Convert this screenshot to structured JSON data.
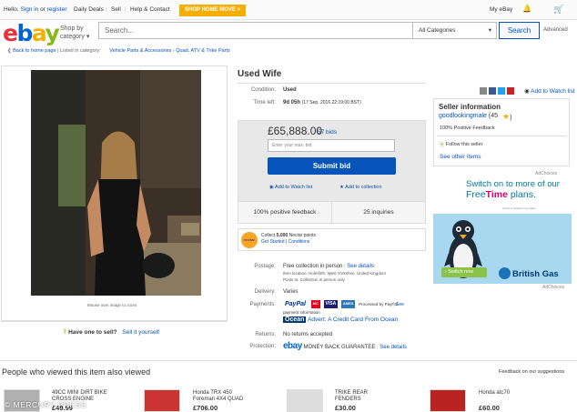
{
  "topbar": {
    "greeting": "Hello.",
    "signin": "Sign in",
    "or": "or",
    "register": "register",
    "daily_deals": "Daily Deals",
    "sell": "Sell",
    "help": "Help & Contact",
    "shop_home": "SHOP HOME MOVE >",
    "my_ebay": "My eBay"
  },
  "header": {
    "shop_by": "Shop by",
    "category": "category",
    "search_placeholder": "Search...",
    "all_categories": "All Categories",
    "search_button": "Search",
    "advanced": "Advanced"
  },
  "breadcrumb": {
    "back": "Back to home page",
    "listed_in": "| Listed in category:",
    "cat1": "Vehicle Parts & Accessories",
    "cat2": "Quad, ATV & Trike Parts"
  },
  "image": {
    "caption": "Mouse over image to zoom"
  },
  "sell_prompt": {
    "have_one": "Have one to sell?",
    "sell_it": "Sell it yourself"
  },
  "item": {
    "title": "Used Wife",
    "condition_label": "Condition:",
    "condition": "Used",
    "time_left_label": "Time left:",
    "time_left": "9d 05h",
    "time_left_detail": "(17 Sep, 2016  22:19:00 BST)"
  },
  "bid": {
    "price": "£65,888.00",
    "bids": "57 bids",
    "max_placeholder": "Enter your max. bid",
    "submit": "Submit bid",
    "add_watch": "Add to Watch list",
    "add_collection": "Add to collection",
    "positive_feedback": "100% positive feedback",
    "inquiries": "25 inquiries"
  },
  "nectar": {
    "logo": "nectar",
    "line1_pre": "Collect ",
    "line1_bold": "5,000",
    "line1_post": " Nectar points",
    "get_started": "Get Started",
    "conditions": "Conditions",
    "sep": " | "
  },
  "social": {
    "add_watch": "Add to Watch list"
  },
  "seller": {
    "heading": "Seller information",
    "name": "goodlookingmale",
    "rating": "(45",
    "rating_end": ")",
    "positive": "100% Positive Feedback",
    "follow": "Follow this seller",
    "see_other": "See other items"
  },
  "ad": {
    "adchoices": "AdChoices",
    "line1": "Switch on to more of our",
    "line2_pre": "Free",
    "line2_highlight": "Time",
    "line2_post": " plans.",
    "fine": "Terms & policies may apply",
    "switch_now": "Switch now",
    "brand": "British Gas"
  },
  "shipping": {
    "postage_label": "Postage:",
    "postage": "Free collection in person",
    "see_details": "See details",
    "item_location": "Item location:  Holmfirth, West Yorkshire, United Kingdom",
    "posts_to": "Posts to:  Collection in person only",
    "delivery_label": "Delivery:",
    "delivery": "Varies",
    "payments_label": "Payments:",
    "processed": "Processed by PayPal",
    "see": "See",
    "payment_info": "payment information",
    "paypal": "PayPal",
    "mastercard": "MC",
    "visa": "VISA",
    "amex": "AMEX",
    "ocean_logo": "Ocean",
    "ocean_text": "Advert: A Credit Card From Ocean",
    "returns_label": "Returns:",
    "returns": "No returns accepted",
    "protection_label": "Protection:",
    "protection_logo": "ebay",
    "protection": "MONEY BACK GUARANTEE",
    "protection_details": "See details"
  },
  "related": {
    "heading": "People who viewed this item also viewed",
    "feedback": "Feedback on our suggestions",
    "items": [
      {
        "title": "49CC MINI DIRT BIKE",
        "subtitle": "CROSS ENGINE",
        "price": "£49.99"
      },
      {
        "title": "Honda TRX 450",
        "subtitle": "Foreman 4X4 QUAD",
        "price": "£706.00"
      },
      {
        "title": "TRIKE REAR",
        "subtitle": "FENDERS",
        "price": "£30.00"
      },
      {
        "title": "Honda atc70",
        "subtitle": "",
        "price": "£60.00"
      }
    ]
  },
  "watermark": "© MERCURY PRESS"
}
